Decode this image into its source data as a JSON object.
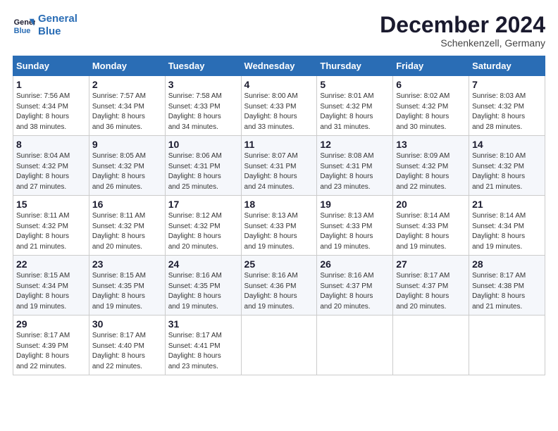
{
  "header": {
    "logo_line1": "General",
    "logo_line2": "Blue",
    "month_title": "December 2024",
    "subtitle": "Schenkenzell, Germany"
  },
  "weekdays": [
    "Sunday",
    "Monday",
    "Tuesday",
    "Wednesday",
    "Thursday",
    "Friday",
    "Saturday"
  ],
  "weeks": [
    [
      {
        "day": "1",
        "info": "Sunrise: 7:56 AM\nSunset: 4:34 PM\nDaylight: 8 hours\nand 38 minutes."
      },
      {
        "day": "2",
        "info": "Sunrise: 7:57 AM\nSunset: 4:34 PM\nDaylight: 8 hours\nand 36 minutes."
      },
      {
        "day": "3",
        "info": "Sunrise: 7:58 AM\nSunset: 4:33 PM\nDaylight: 8 hours\nand 34 minutes."
      },
      {
        "day": "4",
        "info": "Sunrise: 8:00 AM\nSunset: 4:33 PM\nDaylight: 8 hours\nand 33 minutes."
      },
      {
        "day": "5",
        "info": "Sunrise: 8:01 AM\nSunset: 4:32 PM\nDaylight: 8 hours\nand 31 minutes."
      },
      {
        "day": "6",
        "info": "Sunrise: 8:02 AM\nSunset: 4:32 PM\nDaylight: 8 hours\nand 30 minutes."
      },
      {
        "day": "7",
        "info": "Sunrise: 8:03 AM\nSunset: 4:32 PM\nDaylight: 8 hours\nand 28 minutes."
      }
    ],
    [
      {
        "day": "8",
        "info": "Sunrise: 8:04 AM\nSunset: 4:32 PM\nDaylight: 8 hours\nand 27 minutes."
      },
      {
        "day": "9",
        "info": "Sunrise: 8:05 AM\nSunset: 4:32 PM\nDaylight: 8 hours\nand 26 minutes."
      },
      {
        "day": "10",
        "info": "Sunrise: 8:06 AM\nSunset: 4:31 PM\nDaylight: 8 hours\nand 25 minutes."
      },
      {
        "day": "11",
        "info": "Sunrise: 8:07 AM\nSunset: 4:31 PM\nDaylight: 8 hours\nand 24 minutes."
      },
      {
        "day": "12",
        "info": "Sunrise: 8:08 AM\nSunset: 4:31 PM\nDaylight: 8 hours\nand 23 minutes."
      },
      {
        "day": "13",
        "info": "Sunrise: 8:09 AM\nSunset: 4:32 PM\nDaylight: 8 hours\nand 22 minutes."
      },
      {
        "day": "14",
        "info": "Sunrise: 8:10 AM\nSunset: 4:32 PM\nDaylight: 8 hours\nand 21 minutes."
      }
    ],
    [
      {
        "day": "15",
        "info": "Sunrise: 8:11 AM\nSunset: 4:32 PM\nDaylight: 8 hours\nand 21 minutes."
      },
      {
        "day": "16",
        "info": "Sunrise: 8:11 AM\nSunset: 4:32 PM\nDaylight: 8 hours\nand 20 minutes."
      },
      {
        "day": "17",
        "info": "Sunrise: 8:12 AM\nSunset: 4:32 PM\nDaylight: 8 hours\nand 20 minutes."
      },
      {
        "day": "18",
        "info": "Sunrise: 8:13 AM\nSunset: 4:33 PM\nDaylight: 8 hours\nand 19 minutes."
      },
      {
        "day": "19",
        "info": "Sunrise: 8:13 AM\nSunset: 4:33 PM\nDaylight: 8 hours\nand 19 minutes."
      },
      {
        "day": "20",
        "info": "Sunrise: 8:14 AM\nSunset: 4:33 PM\nDaylight: 8 hours\nand 19 minutes."
      },
      {
        "day": "21",
        "info": "Sunrise: 8:14 AM\nSunset: 4:34 PM\nDaylight: 8 hours\nand 19 minutes."
      }
    ],
    [
      {
        "day": "22",
        "info": "Sunrise: 8:15 AM\nSunset: 4:34 PM\nDaylight: 8 hours\nand 19 minutes."
      },
      {
        "day": "23",
        "info": "Sunrise: 8:15 AM\nSunset: 4:35 PM\nDaylight: 8 hours\nand 19 minutes."
      },
      {
        "day": "24",
        "info": "Sunrise: 8:16 AM\nSunset: 4:35 PM\nDaylight: 8 hours\nand 19 minutes."
      },
      {
        "day": "25",
        "info": "Sunrise: 8:16 AM\nSunset: 4:36 PM\nDaylight: 8 hours\nand 19 minutes."
      },
      {
        "day": "26",
        "info": "Sunrise: 8:16 AM\nSunset: 4:37 PM\nDaylight: 8 hours\nand 20 minutes."
      },
      {
        "day": "27",
        "info": "Sunrise: 8:17 AM\nSunset: 4:37 PM\nDaylight: 8 hours\nand 20 minutes."
      },
      {
        "day": "28",
        "info": "Sunrise: 8:17 AM\nSunset: 4:38 PM\nDaylight: 8 hours\nand 21 minutes."
      }
    ],
    [
      {
        "day": "29",
        "info": "Sunrise: 8:17 AM\nSunset: 4:39 PM\nDaylight: 8 hours\nand 22 minutes."
      },
      {
        "day": "30",
        "info": "Sunrise: 8:17 AM\nSunset: 4:40 PM\nDaylight: 8 hours\nand 22 minutes."
      },
      {
        "day": "31",
        "info": "Sunrise: 8:17 AM\nSunset: 4:41 PM\nDaylight: 8 hours\nand 23 minutes."
      },
      null,
      null,
      null,
      null
    ]
  ]
}
